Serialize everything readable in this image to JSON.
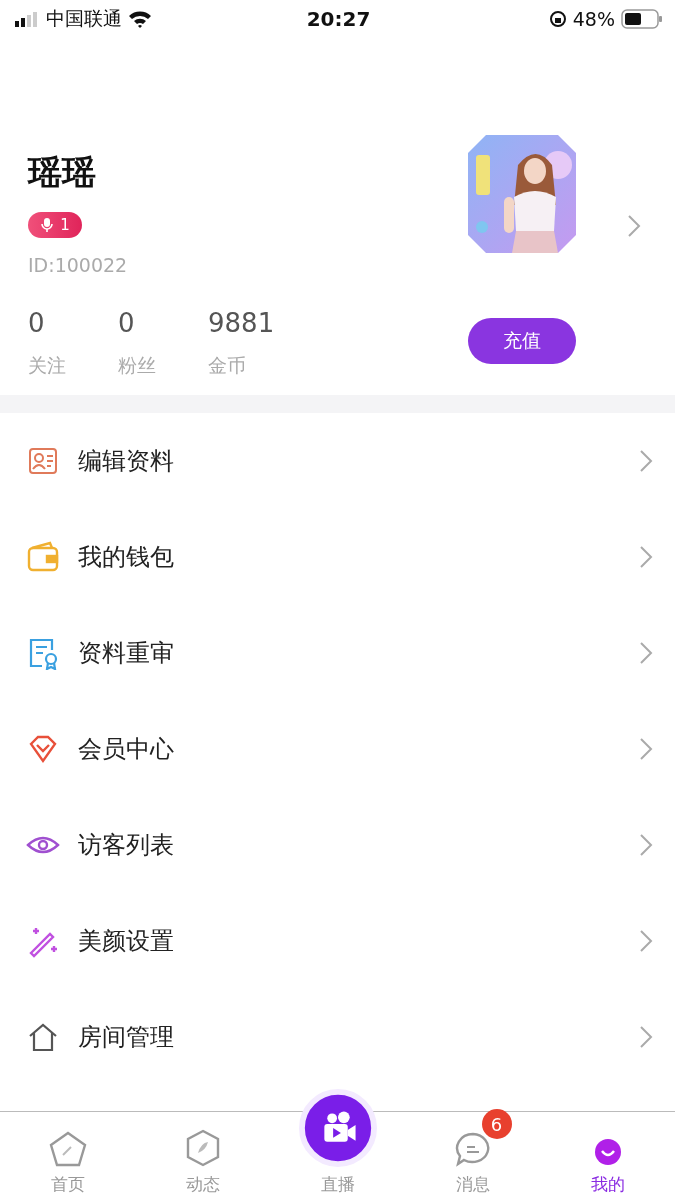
{
  "status_bar": {
    "carrier": "中国联通",
    "time": "20:27",
    "battery": "48%"
  },
  "profile": {
    "name": "瑶瑶",
    "level_badge": "1",
    "id": "ID:100022",
    "stats": [
      {
        "value": "0",
        "label": "关注"
      },
      {
        "value": "0",
        "label": "粉丝"
      },
      {
        "value": "9881",
        "label": "金币"
      }
    ],
    "recharge_button": "充值"
  },
  "menu": [
    {
      "kind": "profile",
      "label": "编辑资料"
    },
    {
      "kind": "wallet",
      "label": "我的钱包"
    },
    {
      "kind": "review",
      "label": "资料重审"
    },
    {
      "kind": "vip",
      "label": "会员中心"
    },
    {
      "kind": "visitors",
      "label": "访客列表"
    },
    {
      "kind": "beauty",
      "label": "美颜设置"
    },
    {
      "kind": "room",
      "label": "房间管理"
    }
  ],
  "tab_bar": [
    {
      "kind": "home",
      "label": "首页",
      "selected": false
    },
    {
      "kind": "feed",
      "label": "动态",
      "selected": false
    },
    {
      "kind": "live",
      "label": "直播",
      "selected": false
    },
    {
      "kind": "messages",
      "label": "消息",
      "selected": false,
      "badge": "6"
    },
    {
      "kind": "me",
      "label": "我的",
      "selected": true
    }
  ]
}
